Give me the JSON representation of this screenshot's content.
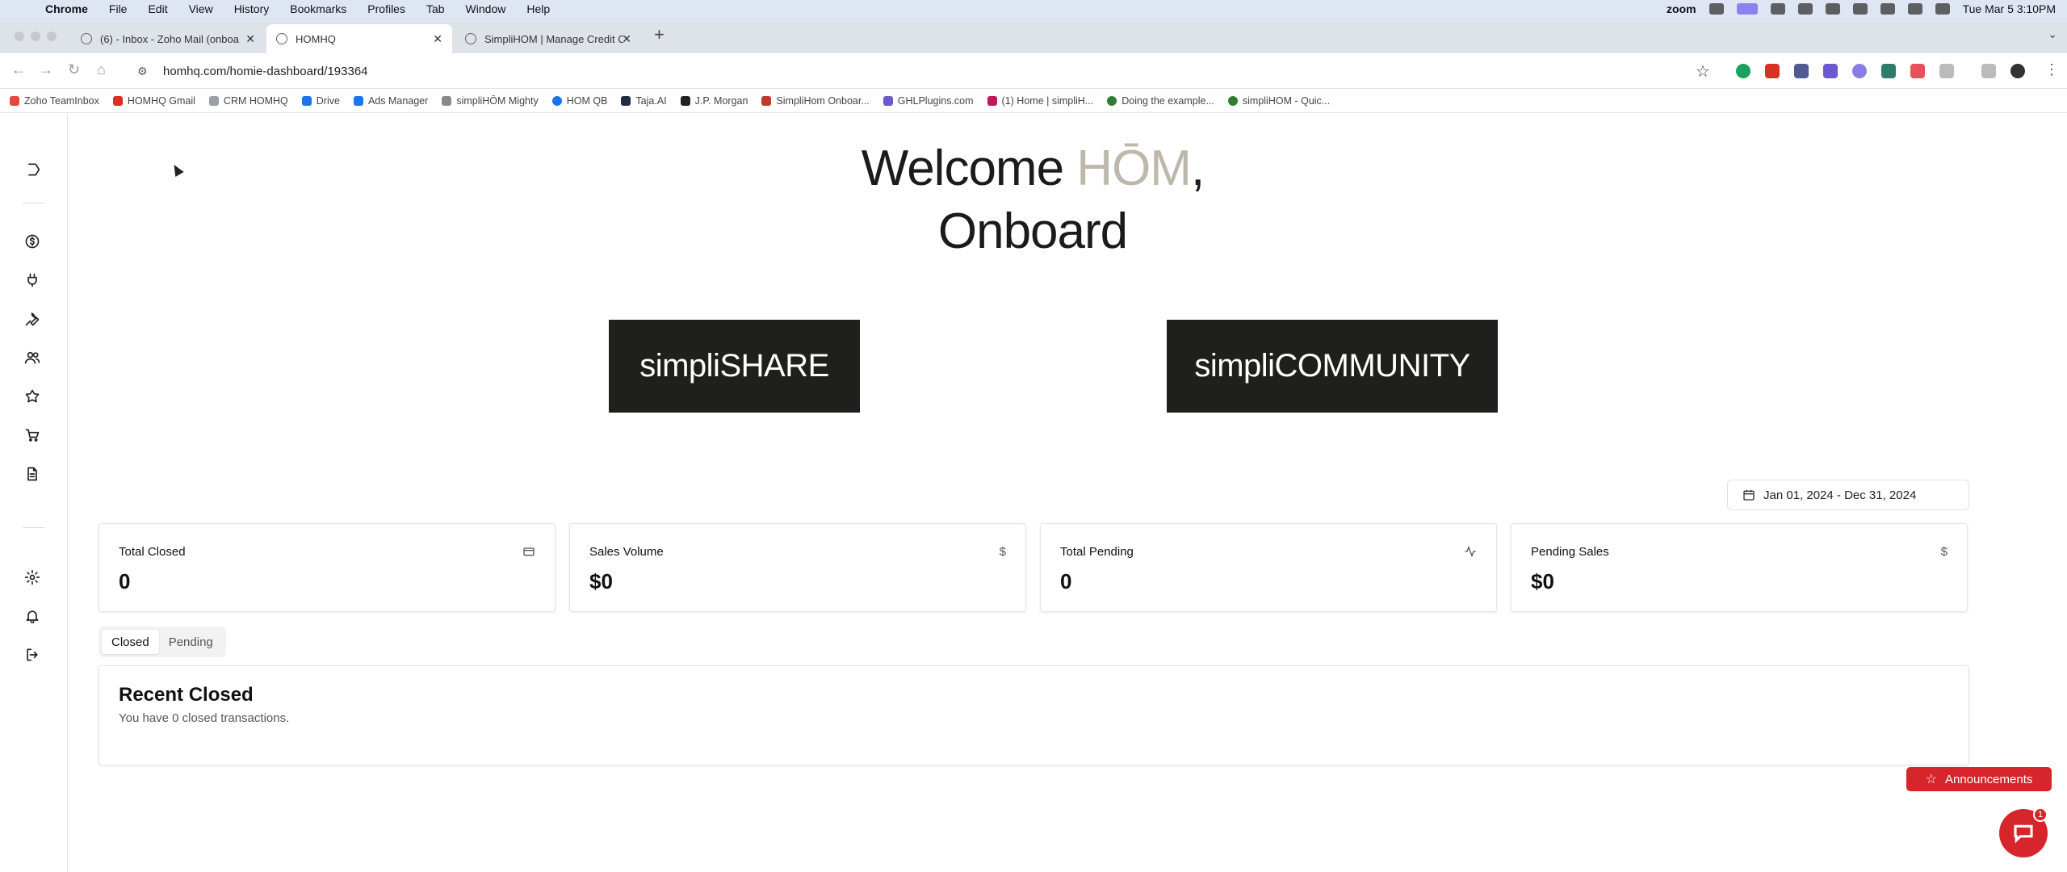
{
  "menubar": {
    "app": "Chrome",
    "items": [
      "File",
      "Edit",
      "View",
      "History",
      "Bookmarks",
      "Profiles",
      "Tab",
      "Window",
      "Help"
    ],
    "zoom_label": "zoom",
    "clock": "Tue Mar 5  3:10PM"
  },
  "browser": {
    "tabs": [
      {
        "label": "(6) - Inbox - Zoho Mail (onboa",
        "active": false
      },
      {
        "label": "HOMHQ",
        "active": true
      },
      {
        "label": "SimpliHOM | Manage Credit C",
        "active": false
      }
    ],
    "url": "homhq.com/homie-dashboard/193364"
  },
  "bookmarks": [
    {
      "label": "Zoho TeamInbox",
      "color": "#e24a3b"
    },
    {
      "label": "HOMHQ Gmail",
      "color": "#d93025"
    },
    {
      "label": "CRM HOMHQ",
      "color": "#9aa0a6"
    },
    {
      "label": "Drive",
      "color": "#1a73e8"
    },
    {
      "label": "Ads Manager",
      "color": "#1877f2"
    },
    {
      "label": "simpliHŌM Mighty",
      "color": "#888888"
    },
    {
      "label": "HOM QB",
      "color": "#1a73e8"
    },
    {
      "label": "Taja.AI",
      "color": "#1f2a44"
    },
    {
      "label": "J.P. Morgan",
      "color": "#222222"
    },
    {
      "label": "SimpliHom Onboar...",
      "color": "#c0392b"
    },
    {
      "label": "GHLPlugins.com",
      "color": "#6a5acd"
    },
    {
      "label": "(1) Home | simpliH...",
      "color": "#c2185b"
    },
    {
      "label": "Doing the example...",
      "color": "#2e7d32"
    },
    {
      "label": "simpliHOM - Quic...",
      "color": "#2e7d32"
    }
  ],
  "page": {
    "welcome_prefix": "Welcome ",
    "welcome_brand": "HŌM",
    "welcome_comma": ",",
    "welcome_line2": "Onboard",
    "simplishare": "simpliSHARE",
    "simplicommunity": "simpliCOMMUNITY",
    "date_range": "Jan 01, 2024 - Dec 31, 2024",
    "cards": [
      {
        "title": "Total Closed",
        "value": "0",
        "icon": "credit-card-icon"
      },
      {
        "title": "Sales Volume",
        "value": "$0",
        "icon": "dollar-icon"
      },
      {
        "title": "Total Pending",
        "value": "0",
        "icon": "activity-icon"
      },
      {
        "title": "Pending Sales",
        "value": "$0",
        "icon": "dollar-icon"
      }
    ],
    "tabs": [
      "Closed",
      "Pending"
    ],
    "recent_title": "Recent Closed",
    "recent_sub": "You have 0 closed transactions.",
    "announcements": "Announcements",
    "chat_badge": "1"
  },
  "colors": {
    "accent_red": "#d6262b",
    "button_dark": "#1f1f1e",
    "brand_taupe": "#beb8aa"
  }
}
